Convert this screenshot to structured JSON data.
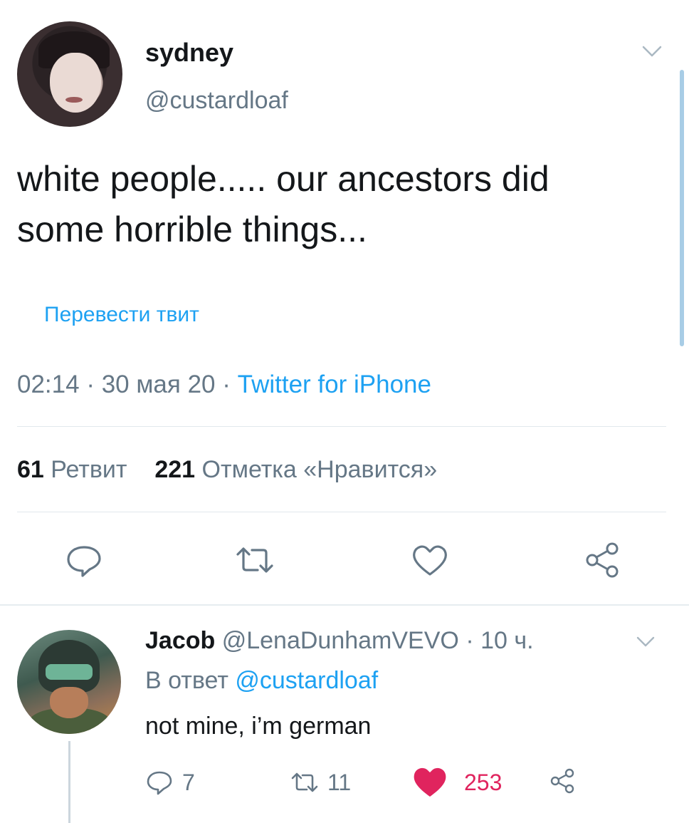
{
  "tweet": {
    "author_name": "sydney",
    "author_handle": "@custardloaf",
    "text": "white people..... our ancestors did\nsome horrible things...",
    "translate_label": "Перевести твит",
    "time": "02:14",
    "date": "30 мая 20",
    "source": "Twitter for iPhone",
    "retweet_count": "61",
    "retweet_label": "Ретвит",
    "like_count": "221",
    "like_label": "Отметка «Нравится»"
  },
  "reply": {
    "author_name": "Jacob",
    "author_handle": "@LenaDunhamVEVO",
    "age": "10 ч.",
    "reply_prefix": "В ответ",
    "reply_to": "@custardloaf",
    "text": "not mine, i’m german",
    "reply_count": "7",
    "retweet_count": "11",
    "like_count": "253"
  },
  "colors": {
    "accent": "#1da1f2",
    "secondary_text": "#657786",
    "like": "#e0245e"
  },
  "icons": [
    "chevron-down-icon",
    "reply-icon",
    "retweet-icon",
    "like-icon",
    "share-icon"
  ]
}
